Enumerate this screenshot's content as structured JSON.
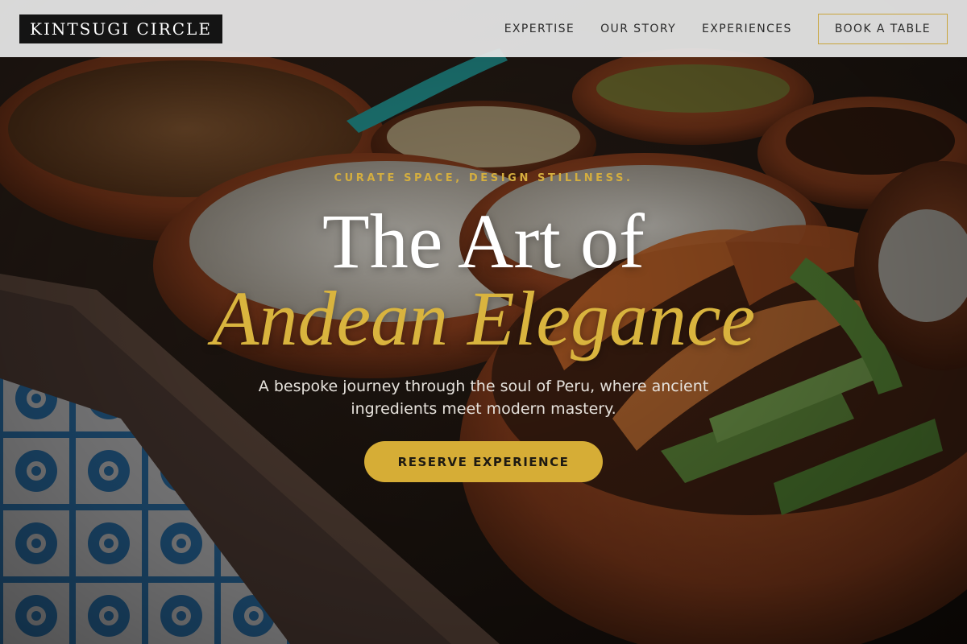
{
  "brand": {
    "logo_text": "KINTSUGI CIRCLE"
  },
  "nav": {
    "items": [
      {
        "label": "EXPERTISE"
      },
      {
        "label": "OUR STORY"
      },
      {
        "label": "EXPERIENCES"
      }
    ],
    "cta_label": "BOOK A TABLE"
  },
  "hero": {
    "eyebrow": "CURATE SPACE, DESIGN STILLNESS.",
    "title_line1": "The Art of",
    "title_line2": "Andean Elegance",
    "subtitle": "A bespoke journey through the soul of Peru, where ancient ingredients meet modern mastery.",
    "cta_label": "RESERVE EXPERIENCE"
  },
  "colors": {
    "accent_gold": "#d6ad36",
    "nav_background": "#e8e8e8",
    "logo_background": "#141414",
    "text_light": "#ffffff"
  }
}
